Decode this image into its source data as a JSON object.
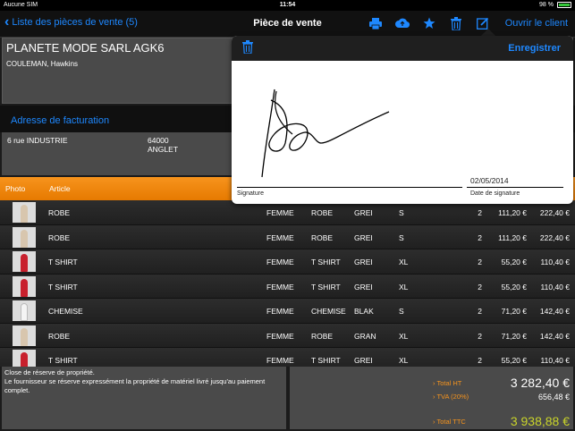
{
  "statusbar": {
    "carrier": "Aucune SIM",
    "time": "11:54",
    "battery": "98 %"
  },
  "navbar": {
    "back_label": "Liste des pièces de vente (5)",
    "title": "Pièce de vente",
    "open_client": "Ouvrir le client"
  },
  "customer": {
    "name": "PLANETE MODE SARL AGK6",
    "contact": "COULEMAN, Hawkins"
  },
  "billing": {
    "section_label": "Adresse de facturation",
    "street": "6 rue INDUSTRIE",
    "postcode": "64000",
    "city": "ANGLET"
  },
  "table": {
    "headers": {
      "photo": "Photo",
      "article": "Article"
    },
    "rows": [
      {
        "photo": "beige",
        "article": "ROBE",
        "gender": "FEMME",
        "family": "ROBE",
        "color": "GREI",
        "size": "S",
        "qty": "2",
        "unit": "111,20 €",
        "total": "222,40 €"
      },
      {
        "photo": "beige",
        "article": "ROBE",
        "gender": "FEMME",
        "family": "ROBE",
        "color": "GREI",
        "size": "S",
        "qty": "2",
        "unit": "111,20 €",
        "total": "222,40 €"
      },
      {
        "photo": "red",
        "article": "T SHIRT",
        "gender": "FEMME",
        "family": "T SHIRT",
        "color": "GREI",
        "size": "XL",
        "qty": "2",
        "unit": "55,20 €",
        "total": "110,40 €"
      },
      {
        "photo": "red",
        "article": "T SHIRT",
        "gender": "FEMME",
        "family": "T SHIRT",
        "color": "GREI",
        "size": "XL",
        "qty": "2",
        "unit": "55,20 €",
        "total": "110,40 €"
      },
      {
        "photo": "white",
        "article": "CHEMISE",
        "gender": "FEMME",
        "family": "CHEMISE",
        "color": "BLAK",
        "size": "S",
        "qty": "2",
        "unit": "71,20 €",
        "total": "142,40 €"
      },
      {
        "photo": "beige",
        "article": "ROBE",
        "gender": "FEMME",
        "family": "ROBE",
        "color": "GRAN",
        "size": "XL",
        "qty": "2",
        "unit": "71,20 €",
        "total": "142,40 €"
      },
      {
        "photo": "red",
        "article": "T SHIRT",
        "gender": "FEMME",
        "family": "T SHIRT",
        "color": "GREI",
        "size": "XL",
        "qty": "2",
        "unit": "55,20 €",
        "total": "110,40 €"
      }
    ]
  },
  "footer": {
    "reserve_title": "Close de réserve de propriété.",
    "reserve_text": "Le fournisseur se réserve expressément la propriété de matériel livré jusqu'au paiement complet.",
    "total_ht_label": "Total HT",
    "total_ht": "3 282,40 €",
    "tva_label": "TVA (20%)",
    "tva": "656,48 €",
    "total_ttc_label": "Total TTC",
    "total_ttc": "3 938,88 €"
  },
  "signature_popover": {
    "save_label": "Enregistrer",
    "signature_label": "Signature",
    "date_value": "02/05/2014",
    "date_label": "Date de signature"
  },
  "colors": {
    "accent": "#1e88ff",
    "orange": "#f7941d",
    "ttc": "#c9d42a"
  },
  "icons": [
    "back-chevron-icon",
    "print-icon",
    "cloud-upload-icon",
    "star-icon",
    "trash-icon",
    "edit-icon"
  ]
}
